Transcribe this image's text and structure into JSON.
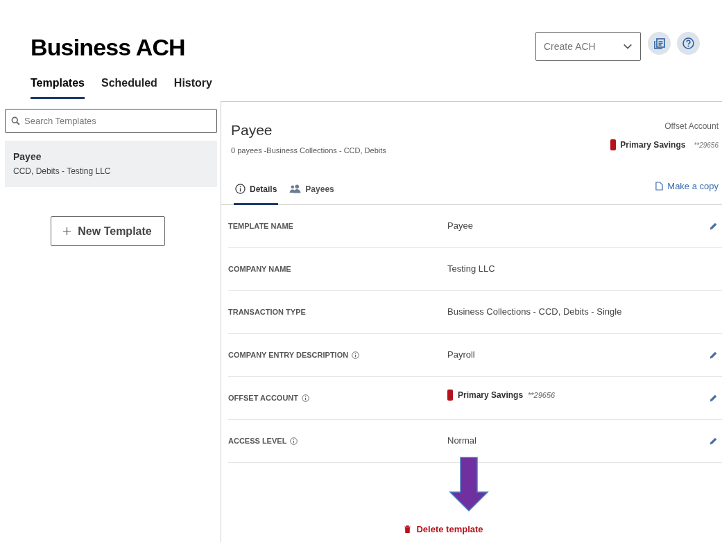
{
  "page_title": "Business ACH",
  "create_menu": {
    "placeholder": "Create ACH"
  },
  "tabs": [
    {
      "label": "Templates",
      "selected": true
    },
    {
      "label": "Scheduled",
      "selected": false
    },
    {
      "label": "History",
      "selected": false
    }
  ],
  "search": {
    "placeholder": "Search Templates"
  },
  "templates": [
    {
      "name": "Payee",
      "subtitle": "CCD, Debits - Testing LLC",
      "selected": true
    }
  ],
  "new_template_button": "New Template",
  "detail": {
    "title": "Payee",
    "subtitle": "0 payees -Business Collections - CCD, Debits",
    "offset_label": "Offset Account",
    "offset_account": {
      "name": "Primary Savings",
      "number": "**29656",
      "color": "#b5121b"
    },
    "tabs": [
      {
        "label": "Details",
        "selected": true
      },
      {
        "label": "Payees",
        "selected": false
      }
    ],
    "copy_link": "Make a copy",
    "fields": [
      {
        "kind": "text",
        "label": "TEMPLATE NAME",
        "info": false,
        "value": "Payee",
        "editable": true
      },
      {
        "kind": "text",
        "label": "COMPANY NAME",
        "info": false,
        "value": "Testing LLC",
        "editable": false
      },
      {
        "kind": "text",
        "label": "TRANSACTION TYPE",
        "info": false,
        "value": "Business Collections - CCD, Debits - Single",
        "editable": false
      },
      {
        "kind": "text",
        "label": "COMPANY ENTRY DESCRIPTION",
        "info": true,
        "value": "Payroll",
        "editable": true
      },
      {
        "kind": "account",
        "label": "OFFSET ACCOUNT",
        "info": true,
        "value": "Primary Savings",
        "number": "**29656",
        "color": "#b5121b",
        "editable": true
      },
      {
        "kind": "text",
        "label": "ACCESS LEVEL",
        "info": true,
        "value": "Normal",
        "editable": true
      }
    ],
    "delete_button": "Delete template"
  }
}
